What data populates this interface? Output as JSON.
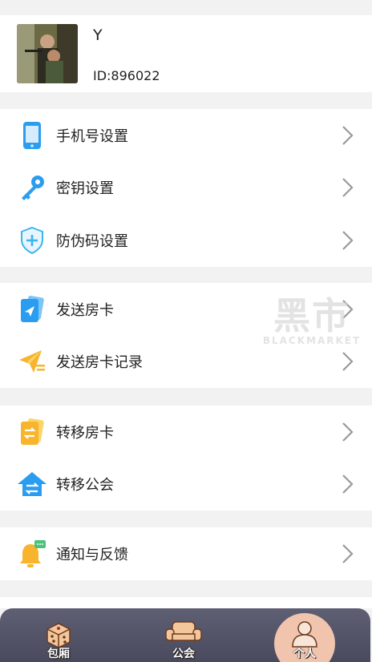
{
  "user": {
    "name": "Y",
    "id_label": "ID:896022"
  },
  "groups": [
    [
      {
        "label": "手机号设置",
        "icon": "phone-icon"
      },
      {
        "label": "密钥设置",
        "icon": "key-icon"
      },
      {
        "label": "防伪码设置",
        "icon": "shield-icon"
      }
    ],
    [
      {
        "label": "发送房卡",
        "icon": "send-card-icon"
      },
      {
        "label": "发送房卡记录",
        "icon": "paper-plane-icon"
      }
    ],
    [
      {
        "label": "转移房卡",
        "icon": "transfer-card-icon"
      },
      {
        "label": "转移公会",
        "icon": "transfer-guild-icon"
      }
    ],
    [
      {
        "label": "通知与反馈",
        "icon": "bell-icon"
      }
    ]
  ],
  "watermark": {
    "big": "黑市",
    "small": "BLACKMARKET"
  },
  "tabs": [
    {
      "label": "包厢",
      "icon": "dice-icon",
      "selected": false
    },
    {
      "label": "公会",
      "icon": "sofa-icon",
      "selected": false
    },
    {
      "label": "个人",
      "icon": "person-icon",
      "selected": true
    }
  ],
  "colors": {
    "accent_blue": "#2b9df0",
    "accent_orange": "#f7b42c",
    "tabbar": "#55556a",
    "selected_tab": "#f1c4ae"
  }
}
